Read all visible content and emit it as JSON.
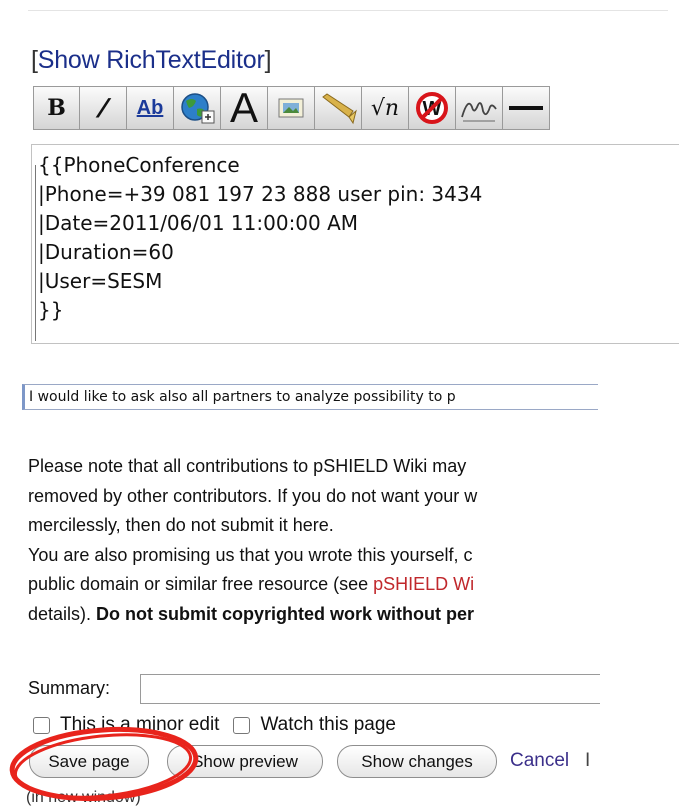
{
  "editor_toggle": {
    "open": "[",
    "label": "Show RichTextEditor",
    "close": "]"
  },
  "toolbar": {
    "buttons": [
      {
        "name": "bold-button",
        "glyph": "B"
      },
      {
        "name": "italic-button",
        "glyph": "/"
      },
      {
        "name": "internal-link-button",
        "glyph": "Ab"
      },
      {
        "name": "external-link-button",
        "glyph": ""
      },
      {
        "name": "headline-button",
        "glyph": "A"
      },
      {
        "name": "embedded-file-button",
        "glyph": ""
      },
      {
        "name": "media-link-button",
        "glyph": ""
      },
      {
        "name": "math-formula-button",
        "glyph": "√n"
      },
      {
        "name": "nowiki-button",
        "glyph": "W"
      },
      {
        "name": "signature-button",
        "glyph": "✍"
      },
      {
        "name": "horizontal-line-button",
        "glyph": ""
      }
    ]
  },
  "editor": {
    "lines": [
      "{{PhoneConference",
      "|Phone=+39 081 197 23 888 user pin: 3434",
      "|Date=2011/06/01 11:00:00 AM",
      "|Duration=60",
      "|User=SESM",
      "}}"
    ]
  },
  "reason_text": "I would like to ask also all partners to analyze possibility to p",
  "notice": {
    "line1": "Please note that all contributions to pSHIELD Wiki may",
    "line2": "removed by other contributors. If you do not want your w",
    "line3": "mercilessly, then do not submit it here.",
    "line4": "You are also promising us that you wrote this yourself, c",
    "line5_pre": "public domain or similar free resource (see ",
    "line5_link": "pSHIELD Wi",
    "line6_pre": "details). ",
    "line6_bold": "Do not submit copyrighted work without per"
  },
  "summary": {
    "label": "Summary:",
    "value": ""
  },
  "options": {
    "minor_edit": "This is a minor edit",
    "watch": "Watch this page"
  },
  "actions": {
    "save": "Save page",
    "preview": "Show preview",
    "changes": "Show changes",
    "cancel": "Cancel",
    "separator": "I",
    "new_window": "(in new window)"
  },
  "colors": {
    "link": "#1b2f8a",
    "highlight_oval": "#e8241c",
    "copyright_link": "#c0282c"
  }
}
